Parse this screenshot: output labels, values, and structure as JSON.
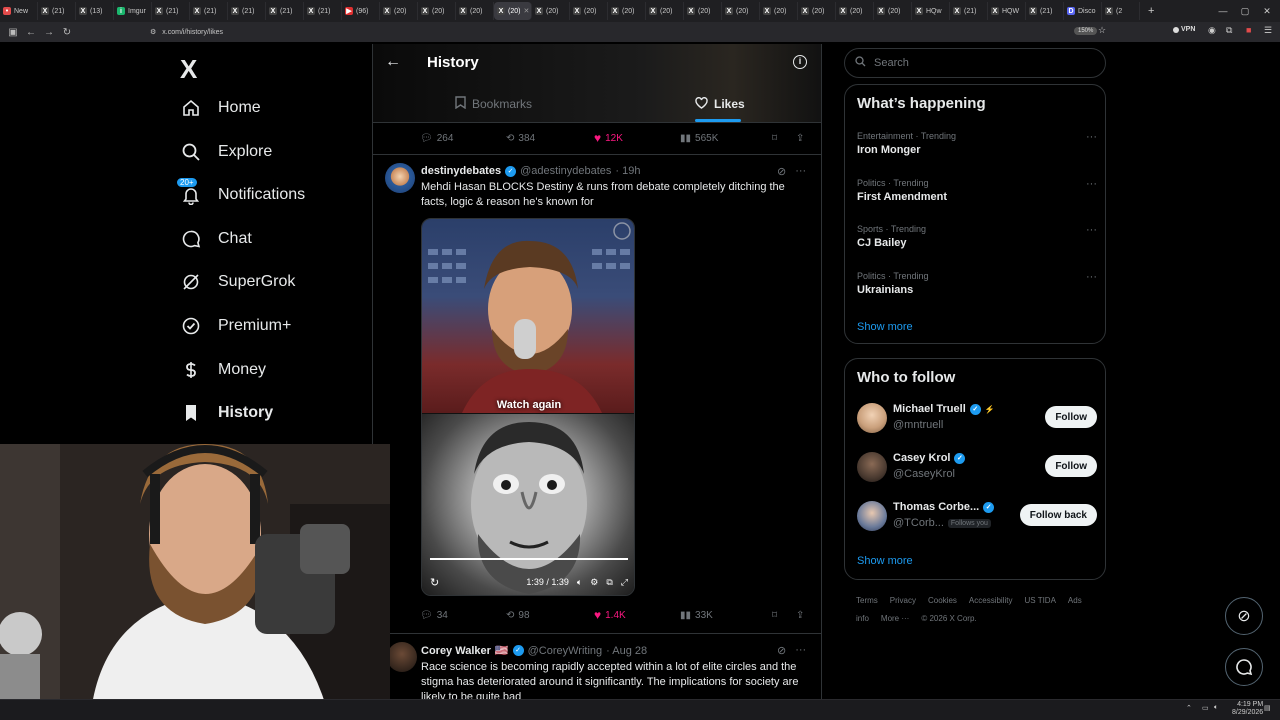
{
  "browser": {
    "tabs": [
      {
        "label": "New",
        "color": "#e34b4b",
        "glyph": "•"
      },
      {
        "label": "(21)",
        "color": "#444",
        "glyph": "X"
      },
      {
        "label": "(13)",
        "color": "#444",
        "glyph": "X"
      },
      {
        "label": "Imgur",
        "color": "#1bb76e",
        "glyph": "i"
      },
      {
        "label": "(21)",
        "color": "#444",
        "glyph": "X"
      },
      {
        "label": "(21)",
        "color": "#444",
        "glyph": "X"
      },
      {
        "label": "(21)",
        "color": "#444",
        "glyph": "X"
      },
      {
        "label": "(21)",
        "color": "#444",
        "glyph": "X"
      },
      {
        "label": "(21)",
        "color": "#444",
        "glyph": "X"
      },
      {
        "label": "(96)",
        "color": "#e03030",
        "glyph": "▶"
      },
      {
        "label": "(20)",
        "color": "#444",
        "glyph": "X"
      },
      {
        "label": "(20)",
        "color": "#444",
        "glyph": "X"
      },
      {
        "label": "(20)",
        "color": "#444",
        "glyph": "X"
      },
      {
        "label": "(20)",
        "color": "#444",
        "glyph": "X"
      },
      {
        "label": "(20)",
        "color": "#444",
        "glyph": "X"
      },
      {
        "label": "(20)",
        "color": "#444",
        "glyph": "X"
      },
      {
        "label": "(20)",
        "color": "#444",
        "glyph": "X"
      },
      {
        "label": "(20)",
        "color": "#444",
        "glyph": "X"
      },
      {
        "label": "(20)",
        "color": "#444",
        "glyph": "X"
      },
      {
        "label": "(20)",
        "color": "#444",
        "glyph": "X"
      },
      {
        "label": "(20)",
        "color": "#444",
        "glyph": "X"
      },
      {
        "label": "(20)",
        "color": "#444",
        "glyph": "X"
      },
      {
        "label": "(20)",
        "color": "#444",
        "glyph": "X"
      },
      {
        "label": "(20)",
        "color": "#444",
        "glyph": "X"
      },
      {
        "label": "HQw",
        "color": "#444",
        "glyph": "X"
      },
      {
        "label": "(21)",
        "color": "#444",
        "glyph": "X"
      },
      {
        "label": "HQW",
        "color": "#444",
        "glyph": "X"
      },
      {
        "label": "(21)",
        "color": "#444",
        "glyph": "X"
      },
      {
        "label": "Disco",
        "color": "#5865f2",
        "glyph": "D"
      },
      {
        "label": "(2",
        "color": "#444",
        "glyph": "X"
      }
    ],
    "active_tab_index": 13,
    "url": "x.com/i/history/likes",
    "zoom": "150%",
    "vpn_label": "VPN"
  },
  "leftnav": {
    "logo": "X",
    "items": [
      {
        "label": "Home",
        "icon": "home-icon"
      },
      {
        "label": "Explore",
        "icon": "search-icon"
      },
      {
        "label": "Notifications",
        "icon": "bell-icon",
        "badge": "20+"
      },
      {
        "label": "Chat",
        "icon": "chat-icon"
      },
      {
        "label": "SuperGrok",
        "icon": "grok-icon"
      },
      {
        "label": "Premium+",
        "icon": "premium-icon"
      },
      {
        "label": "Money",
        "icon": "money-icon"
      },
      {
        "label": "History",
        "icon": "bookmark-icon",
        "active": true
      }
    ]
  },
  "center": {
    "title": "History",
    "tabs": {
      "bookmarks": "Bookmarks",
      "likes": "Likes"
    },
    "prev_actions": {
      "replies": "264",
      "reposts": "384",
      "likes": "12K",
      "views": "565K"
    },
    "tweet1": {
      "name": "destinydebates",
      "handle": "@adestinydebates",
      "time": "· 19h",
      "text": "Mehdi Hasan BLOCKS Destiny & runs from debate completely ditching the facts, logic & reason he's known for",
      "watch_again": "Watch again",
      "video_time": "1:39 / 1:39",
      "video_progress": 1.0,
      "actions": {
        "replies": "34",
        "reposts": "98",
        "likes": "1.4K",
        "views": "33K"
      }
    },
    "tweet2": {
      "name": "Corey Walker",
      "flag": "🇺🇸",
      "handle": "@CoreyWriting",
      "time": "· Aug 28",
      "text": "Race science is becoming rapidly accepted within a lot of elite circles and the stigma has deteriorated around it significantly. The implications for society are likely to be quite bad"
    }
  },
  "right": {
    "search_placeholder": "Search",
    "happening_title": "What’s happening",
    "trends": [
      {
        "category": "Entertainment · Trending",
        "name": "Iron Monger"
      },
      {
        "category": "Politics · Trending",
        "name": "First Amendment"
      },
      {
        "category": "Sports · Trending",
        "name": "CJ Bailey"
      },
      {
        "category": "Politics · Trending",
        "name": "Ukrainians"
      }
    ],
    "show_more": "Show more",
    "who_title": "Who to follow",
    "follow": [
      {
        "name": "Michael Truell",
        "handle": "@mntruell",
        "button": "Follow",
        "extra": "⚡"
      },
      {
        "name": "Casey Krol",
        "handle": "@CaseyKrol",
        "button": "Follow"
      },
      {
        "name": "Thomas Corbe...",
        "handle": "@TCorb...",
        "button": "Follow back",
        "follows_you": "Follows you"
      }
    ],
    "footer": [
      "Terms",
      "Privacy",
      "Cookies",
      "Accessibility",
      "US TIDA",
      "Ads info",
      "More ···",
      "© 2026 X Corp."
    ]
  },
  "taskbar": {
    "time": "4:19 PM",
    "date": "8/29/2026"
  }
}
